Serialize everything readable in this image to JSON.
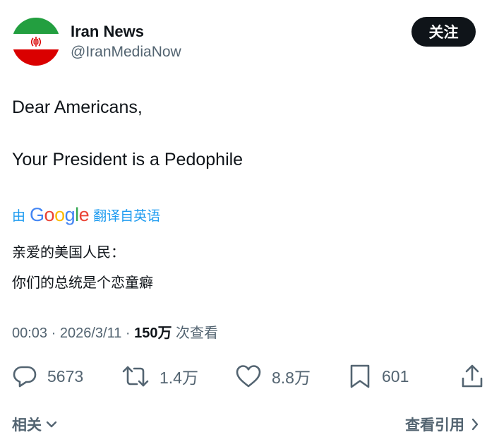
{
  "author": {
    "display_name": "Iran News",
    "handle": "@IranMediaNow",
    "avatar_icon": "iran-flag-icon",
    "flag_colors": {
      "green": "#239f40",
      "white": "#ffffff",
      "red": "#da0000"
    }
  },
  "follow_button": {
    "label": "关注"
  },
  "tweet": {
    "lines": [
      "Dear Americans,",
      "Your President is a Pedophile"
    ]
  },
  "translation": {
    "prefix": "由",
    "provider_letters": [
      "G",
      "o",
      "o",
      "g",
      "l",
      "e"
    ],
    "suffix": "翻译自英语",
    "lines": [
      "亲爱的美国人民：",
      "你们的总统是个恋童癖"
    ]
  },
  "meta": {
    "time": "00:03",
    "separator": " · ",
    "date": "2026/3/11",
    "views_count": "150万",
    "views_label": " 次查看"
  },
  "actions": {
    "replies": "5673",
    "retweets": "1.4万",
    "likes": "8.8万",
    "bookmarks": "601"
  },
  "footer": {
    "related_label": "相关",
    "quotes_label": "查看引用"
  },
  "colors": {
    "text": "#0f1419",
    "secondary": "#536471",
    "link": "#1d9bf0",
    "button_bg": "#0f1419"
  }
}
